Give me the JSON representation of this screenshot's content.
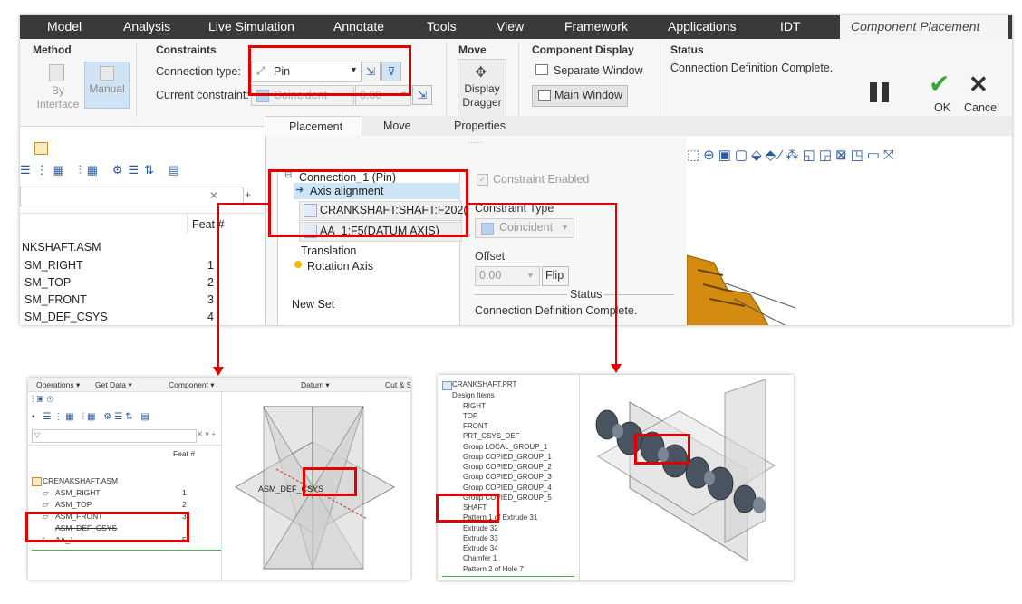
{
  "menubar": {
    "items": [
      "Model",
      "Analysis",
      "Live Simulation",
      "Annotate",
      "Tools",
      "View",
      "Framework",
      "Applications",
      "IDT"
    ],
    "active_tab": "Component Placement"
  },
  "ribbon": {
    "method": {
      "title": "Method",
      "by_interface": "By\nInterface",
      "manual": "Manual"
    },
    "constraints": {
      "title": "Constraints",
      "connection_type_label": "Connection type:",
      "connection_type_value": "Pin",
      "current_constraint_label": "Current constraint:",
      "current_constraint_value": "Coincident",
      "offset_value": "0.00"
    },
    "move": {
      "title": "Move",
      "display_dragger": "Display\nDragger"
    },
    "component_display": {
      "title": "Component Display",
      "separate_window": "Separate Window",
      "main_window": "Main Window"
    },
    "status": {
      "title": "Status",
      "text": "Connection Definition Complete."
    },
    "ok": "OK",
    "cancel": "Cancel"
  },
  "panel_tabs": [
    "Placement",
    "Move",
    "Properties"
  ],
  "placement_panel": {
    "connection": "Connection_1 (Pin)",
    "axis_alignment": "Axis alignment",
    "ref1": "CRANKSHAFT:SHAFT:F202(",
    "ref2": "AA_1:F5(DATUM AXIS)",
    "translation": "Translation",
    "rotation_axis": "Rotation Axis",
    "new_set": "New Set",
    "constraint_enabled": "Constraint Enabled",
    "constraint_type_label": "Constraint Type",
    "constraint_type_value": "Coincident",
    "offset_label": "Offset",
    "offset_value": "0.00",
    "flip": "Flip",
    "status_label": "Status",
    "status_text": "Connection Definition Complete."
  },
  "model_tree": {
    "feat_header": "Feat #",
    "rows": [
      {
        "name": "NKSHAFT.ASM",
        "feat": ""
      },
      {
        "name": "SM_RIGHT",
        "feat": "1"
      },
      {
        "name": "SM_TOP",
        "feat": "2"
      },
      {
        "name": "SM_FRONT",
        "feat": "3"
      },
      {
        "name": "SM_DEF_CSYS",
        "feat": "4"
      }
    ]
  },
  "bottom_left": {
    "toolbar": [
      "Operations ▾",
      "Get Data ▾",
      "Component ▾",
      "Datum ▾",
      "Cut & S"
    ],
    "feat_header": "Feat #",
    "rows": [
      {
        "name": "CRENAKSHAFT.ASM",
        "feat": ""
      },
      {
        "name": "ASM_RIGHT",
        "feat": "1"
      },
      {
        "name": "ASM_TOP",
        "feat": "2"
      },
      {
        "name": "ASM_FRONT",
        "feat": "3"
      },
      {
        "name": "ASM_DEF_CSYS",
        "feat": ""
      },
      {
        "name": "AA_1",
        "feat": "5"
      }
    ],
    "csys_label": "ASM_DEF_CSYS"
  },
  "bottom_right": {
    "rows": [
      "CRANKSHAFT.PRT",
      "Design Items",
      "RIGHT",
      "TOP",
      "FRONT",
      "PRT_CSYS_DEF",
      "Group LOCAL_GROUP_1",
      "Group COPIED_GROUP_1",
      "Group COPIED_GROUP_2",
      "Group COPIED_GROUP_3",
      "Group COPIED_GROUP_4",
      "Group COPIED_GROUP_5",
      "SHAFT",
      "Pattern 1 of Extrude 31",
      "Extrude 32",
      "Extrude 33",
      "Extrude 34",
      "Chamfer 1",
      "Pattern 2 of Hole 7"
    ]
  },
  "colors": {
    "accent_red": "#e00000",
    "menubar": "#3a3a3a",
    "ok_green": "#3aa53a",
    "selection_blue": "#cde4f7"
  }
}
